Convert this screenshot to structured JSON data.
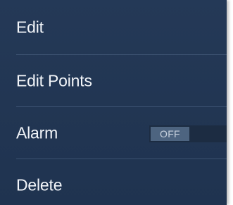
{
  "menu": {
    "items": [
      {
        "label": "Edit"
      },
      {
        "label": "Edit Points"
      },
      {
        "label": "Alarm",
        "toggle": {
          "state_label": "OFF",
          "on": false
        }
      },
      {
        "label": "Delete"
      }
    ]
  },
  "colors": {
    "menu_background": "#233754",
    "divider": "#3b5170",
    "text": "#f2f5f9",
    "toggle_track": "#1c2c42",
    "toggle_knob": "#4d6480"
  }
}
